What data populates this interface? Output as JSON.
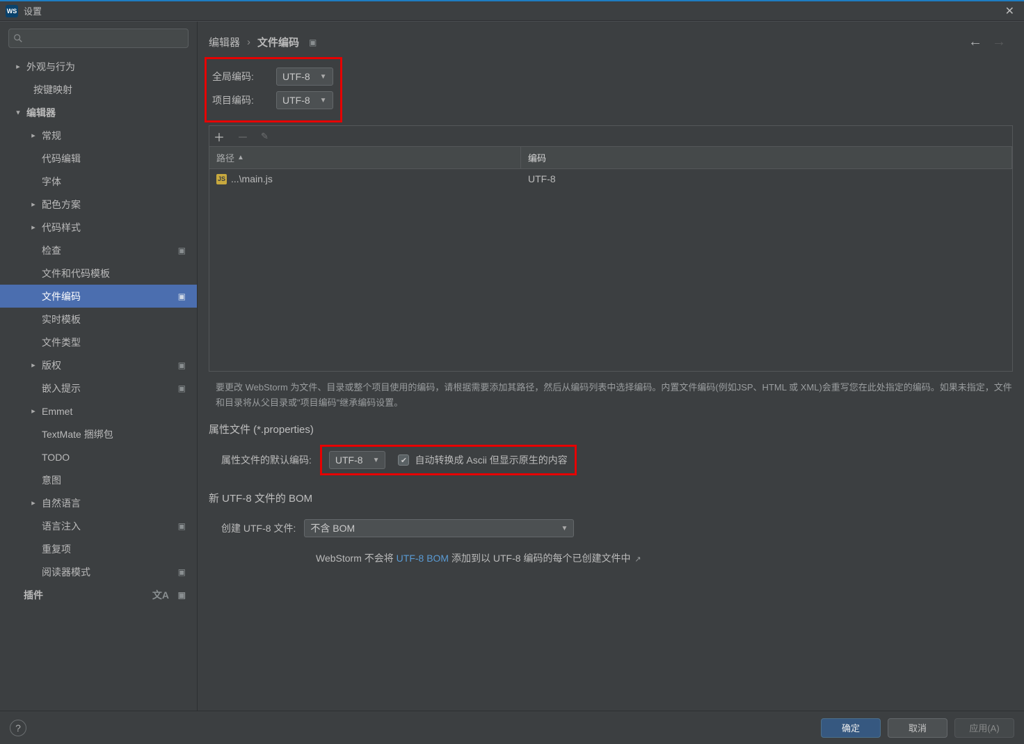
{
  "title": "设置",
  "search_placeholder": "",
  "tree": {
    "appearance": "外观与行为",
    "keymap": "按键映射",
    "editor": "编辑器",
    "general": "常规",
    "code_editing": "代码编辑",
    "font": "字体",
    "color_scheme": "配色方案",
    "code_style": "代码样式",
    "inspections": "检查",
    "file_templates": "文件和代码模板",
    "file_encoding": "文件编码",
    "live_templates": "实时模板",
    "file_types": "文件类型",
    "copyright": "版权",
    "inlay_hints": "嵌入提示",
    "emmet": "Emmet",
    "textmate": "TextMate 捆绑包",
    "todo": "TODO",
    "intentions": "意图",
    "natural_lang": "自然语言",
    "lang_inject": "语言注入",
    "duplicates": "重复项",
    "reader_mode": "阅读器模式",
    "plugins": "插件"
  },
  "breadcrumb": {
    "parent": "编辑器",
    "current": "文件编码"
  },
  "encodings": {
    "global_label": "全局编码:",
    "global_value": "UTF-8",
    "project_label": "项目编码:",
    "project_value": "UTF-8"
  },
  "table": {
    "path_header": "路径",
    "enc_header": "编码",
    "rows": [
      {
        "path": "...\\main.js",
        "enc": "UTF-8"
      }
    ]
  },
  "help_text": "要更改 WebStorm 为文件、目录或整个项目使用的编码，请根据需要添加其路径，然后从编码列表中选择编码。内置文件编码(例如JSP、HTML 或 XML)会重写您在此处指定的编码。如果未指定，文件和目录将从父目录或\"项目编码\"继承编码设置。",
  "properties_section_title": "属性文件 (*.properties)",
  "properties_default_label": "属性文件的默认编码:",
  "properties_default_value": "UTF-8",
  "ascii_checkbox_label": "自动转换成 Ascii 但显示原生的内容",
  "bom_section_title": "新 UTF-8 文件的 BOM",
  "bom_create_label": "创建 UTF-8 文件:",
  "bom_create_value": "不含 BOM",
  "bom_note_prefix": "WebStorm 不会将 ",
  "bom_note_link": "UTF-8 BOM",
  "bom_note_suffix": " 添加到以 UTF-8 编码的每个已创建文件中",
  "buttons": {
    "ok": "确定",
    "cancel": "取消",
    "apply": "应用(A)"
  }
}
